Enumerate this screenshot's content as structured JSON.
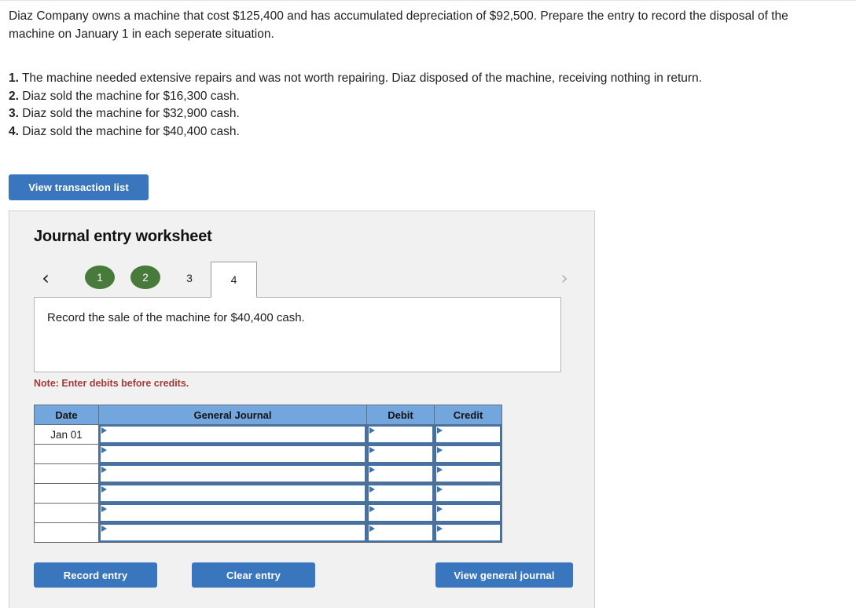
{
  "problem": {
    "statement": "Diaz Company owns a machine that cost $125,400 and has accumulated depreciation of $92,500. Prepare the entry to record the disposal of the machine on January 1 in each seperate situation.",
    "situations": [
      {
        "num": "1.",
        "text": "The machine needed extensive repairs and was not worth repairing. Diaz disposed of the machine, receiving nothing in return."
      },
      {
        "num": "2.",
        "text": "Diaz sold the machine for $16,300 cash."
      },
      {
        "num": "3.",
        "text": "Diaz sold the machine for $32,900 cash."
      },
      {
        "num": "4.",
        "text": "Diaz sold the machine for $40,400 cash."
      }
    ]
  },
  "toolbar": {
    "view_transaction_list_label": "View transaction list"
  },
  "worksheet": {
    "title": "Journal entry worksheet",
    "prev_arrow": "‹",
    "next_arrow": "›",
    "tabs": [
      {
        "label": "1",
        "state": "completed"
      },
      {
        "label": "2",
        "state": "completed"
      },
      {
        "label": "3",
        "state": "pending"
      },
      {
        "label": "4",
        "state": "active"
      }
    ],
    "description": "Record the sale of the machine for $40,400 cash.",
    "note": "Note: Enter debits before credits."
  },
  "journal": {
    "columns": [
      "Date",
      "General Journal",
      "Debit",
      "Credit"
    ],
    "rows": [
      {
        "date": "Jan 01",
        "general_journal": "",
        "debit": "",
        "credit": ""
      },
      {
        "date": "",
        "general_journal": "",
        "debit": "",
        "credit": ""
      },
      {
        "date": "",
        "general_journal": "",
        "debit": "",
        "credit": ""
      },
      {
        "date": "",
        "general_journal": "",
        "debit": "",
        "credit": ""
      },
      {
        "date": "",
        "general_journal": "",
        "debit": "",
        "credit": ""
      },
      {
        "date": "",
        "general_journal": "",
        "debit": "",
        "credit": ""
      }
    ]
  },
  "footer": {
    "record_entry_label": "Record entry",
    "clear_entry_label": "Clear entry",
    "view_general_journal_label": "View general journal"
  },
  "colors": {
    "button_blue": "#3a76bd",
    "tab_green": "#487a3c",
    "table_header_blue": "#73a6dd",
    "input_border_blue": "#3d72ae",
    "note_red": "#a33a34",
    "panel_gray": "#f1f1f1"
  }
}
